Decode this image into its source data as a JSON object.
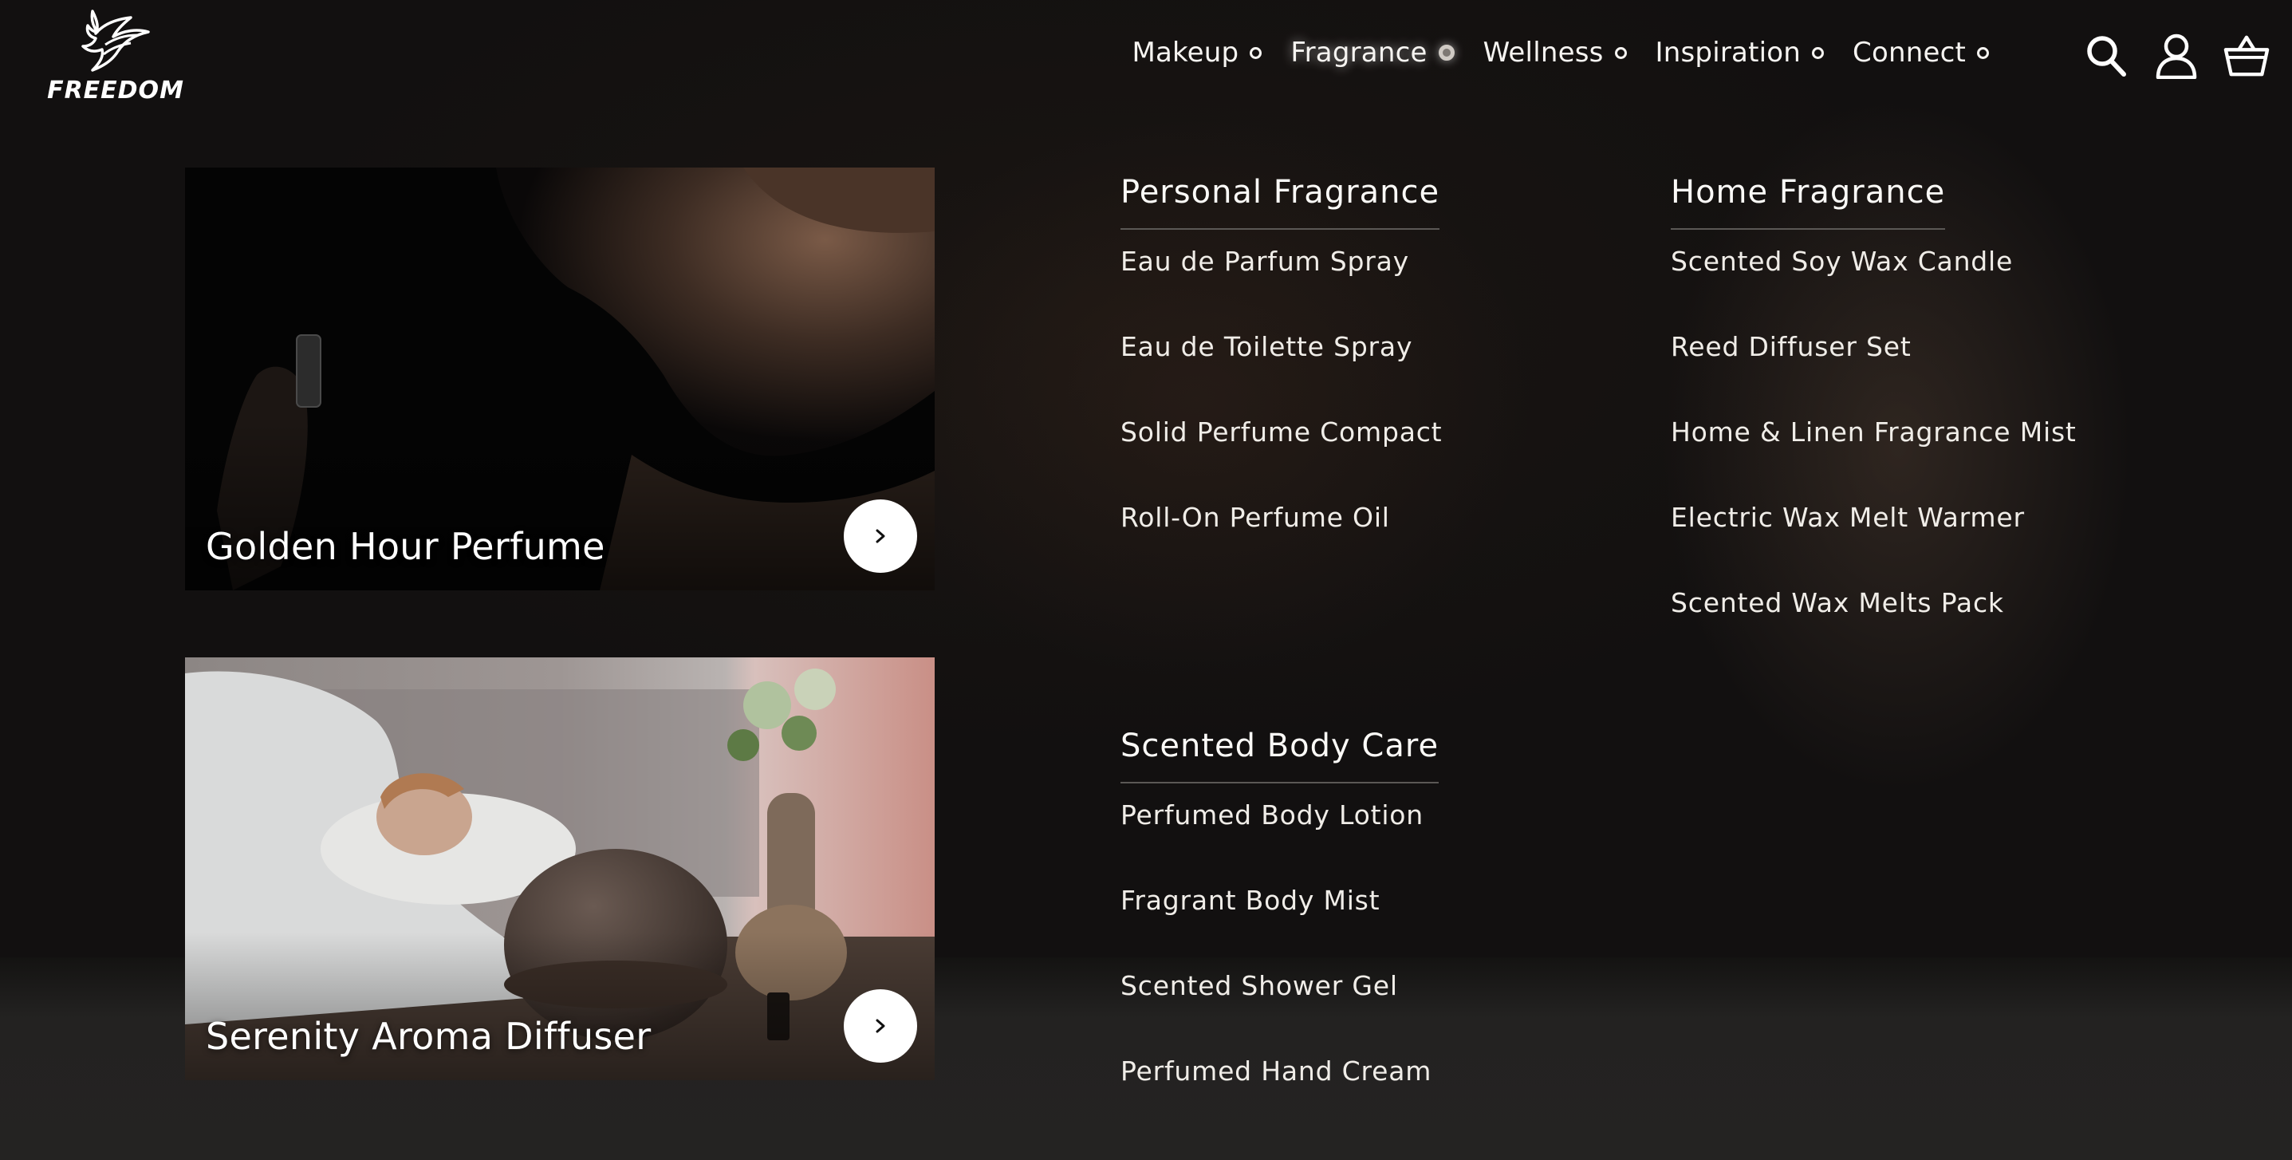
{
  "brand": {
    "name": "FREEDOM"
  },
  "nav": {
    "items": [
      {
        "label": "Makeup",
        "active": false
      },
      {
        "label": "Fragrance",
        "active": true
      },
      {
        "label": "Wellness",
        "active": false
      },
      {
        "label": "Inspiration",
        "active": false
      },
      {
        "label": "Connect",
        "active": false
      }
    ],
    "icons": [
      "search-icon",
      "user-icon",
      "basket-icon"
    ]
  },
  "featured": [
    {
      "title": "Golden Hour Perfume",
      "icon": "chevron-right-icon"
    },
    {
      "title": "Serenity Aroma Diffuser",
      "icon": "chevron-right-icon"
    }
  ],
  "menu": {
    "personal": {
      "heading": "Personal Fragrance",
      "items": [
        "Eau de Parfum Spray",
        "Eau de Toilette Spray",
        "Solid Perfume Compact",
        "Roll-On Perfume Oil"
      ]
    },
    "home": {
      "heading": "Home Fragrance",
      "items": [
        "Scented Soy Wax Candle",
        "Reed Diffuser Set",
        "Home & Linen Fragrance Mist",
        "Electric Wax Melt Warmer",
        "Scented Wax Melts Pack"
      ]
    },
    "body": {
      "heading": "Scented Body Care",
      "items": [
        "Perfumed Body Lotion",
        "Fragrant Body Mist",
        "Scented Shower Gel",
        "Perfumed Hand Cream"
      ]
    }
  },
  "colors": {
    "background": "#1b1a19",
    "text": "#f2efea",
    "divider": "#5b5855",
    "button": "#ffffff"
  }
}
